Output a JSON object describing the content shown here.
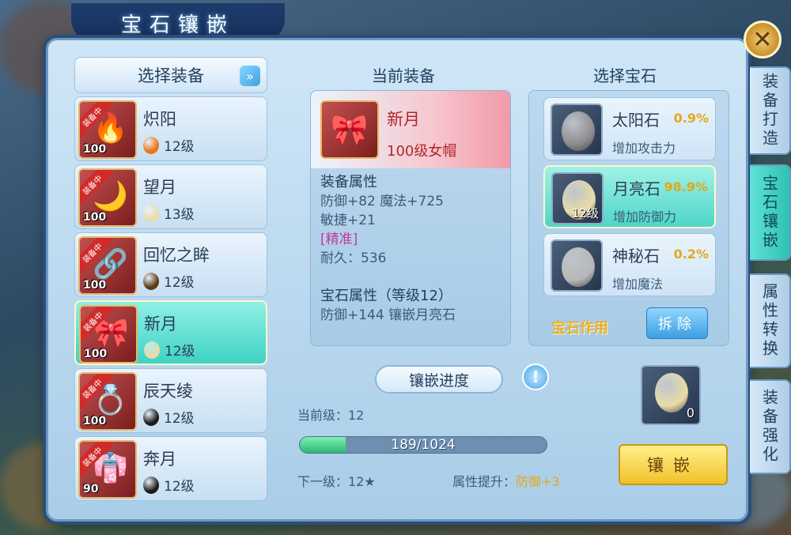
{
  "window": {
    "title": "宝石镶嵌"
  },
  "left": {
    "header": "选择装备",
    "items": [
      {
        "name": "炽阳",
        "level": "100",
        "ribbon": "装备中",
        "gem_level": "12级",
        "gem_color": "#e8741a",
        "icon": "🔥",
        "selected": false
      },
      {
        "name": "望月",
        "level": "100",
        "ribbon": "装备中",
        "gem_level": "13级",
        "gem_color": "#e9dca8",
        "icon": "🌙",
        "selected": false
      },
      {
        "name": "回忆之眸",
        "level": "100",
        "ribbon": "装备中",
        "gem_level": "12级",
        "gem_color": "#5b3a16",
        "icon": "🔗",
        "selected": false
      },
      {
        "name": "新月",
        "level": "100",
        "ribbon": "装备中",
        "gem_level": "12级",
        "gem_color": "#e9dca8",
        "icon": "🎀",
        "selected": true
      },
      {
        "name": "辰天绫",
        "level": "100",
        "ribbon": "装备中",
        "gem_level": "12级",
        "gem_color": "#1a1a1a",
        "icon": "💍",
        "selected": false
      },
      {
        "name": "奔月",
        "level": "90",
        "ribbon": "装备中",
        "gem_level": "12级",
        "gem_color": "#1a1a1a",
        "icon": "👘",
        "selected": false
      }
    ]
  },
  "middle": {
    "title": "当前装备",
    "equip_name": "新月",
    "equip_sub": "100级女帽",
    "attr_head": "装备属性",
    "attr_line1": "防御+82 魔法+725",
    "attr_line2": "敏捷+21",
    "attr_refined": "[精准]",
    "attr_durability": "耐久：536",
    "gem_head": "宝石属性（等级12）",
    "gem_line": "防御+144 镶嵌月亮石"
  },
  "progress": {
    "title": "镶嵌进度",
    "current_level": "当前级：12",
    "bar_text": "189/1024",
    "fraction": 0.185,
    "next_level": "下一级：12★",
    "attr_up_label": "属性提升：",
    "attr_up_value": "防御+3"
  },
  "right": {
    "title": "选择宝石",
    "gems": [
      {
        "name": "太阳石",
        "pct": "0.9%",
        "desc": "增加攻击力",
        "color": "#8c8c8c",
        "level": "",
        "selected": false
      },
      {
        "name": "月亮石",
        "pct": "98.9%",
        "desc": "增加防御力",
        "color": "#e9dca8",
        "level": "12级",
        "selected": true
      },
      {
        "name": "神秘石",
        "pct": "0.2%",
        "desc": "增加魔法",
        "color": "#b8b8b8",
        "level": "",
        "selected": false
      }
    ],
    "effect_link": "宝石作用",
    "remove_btn": "拆除",
    "slot_count": "0",
    "embed_btn": "镶嵌"
  },
  "tabs": [
    {
      "label": "装备打造",
      "active": false
    },
    {
      "label": "宝石镶嵌",
      "active": true
    },
    {
      "label": "属性转换",
      "active": false
    },
    {
      "label": "装备强化",
      "active": false
    }
  ],
  "icons": {
    "close": "close-icon",
    "info": "info-icon"
  }
}
